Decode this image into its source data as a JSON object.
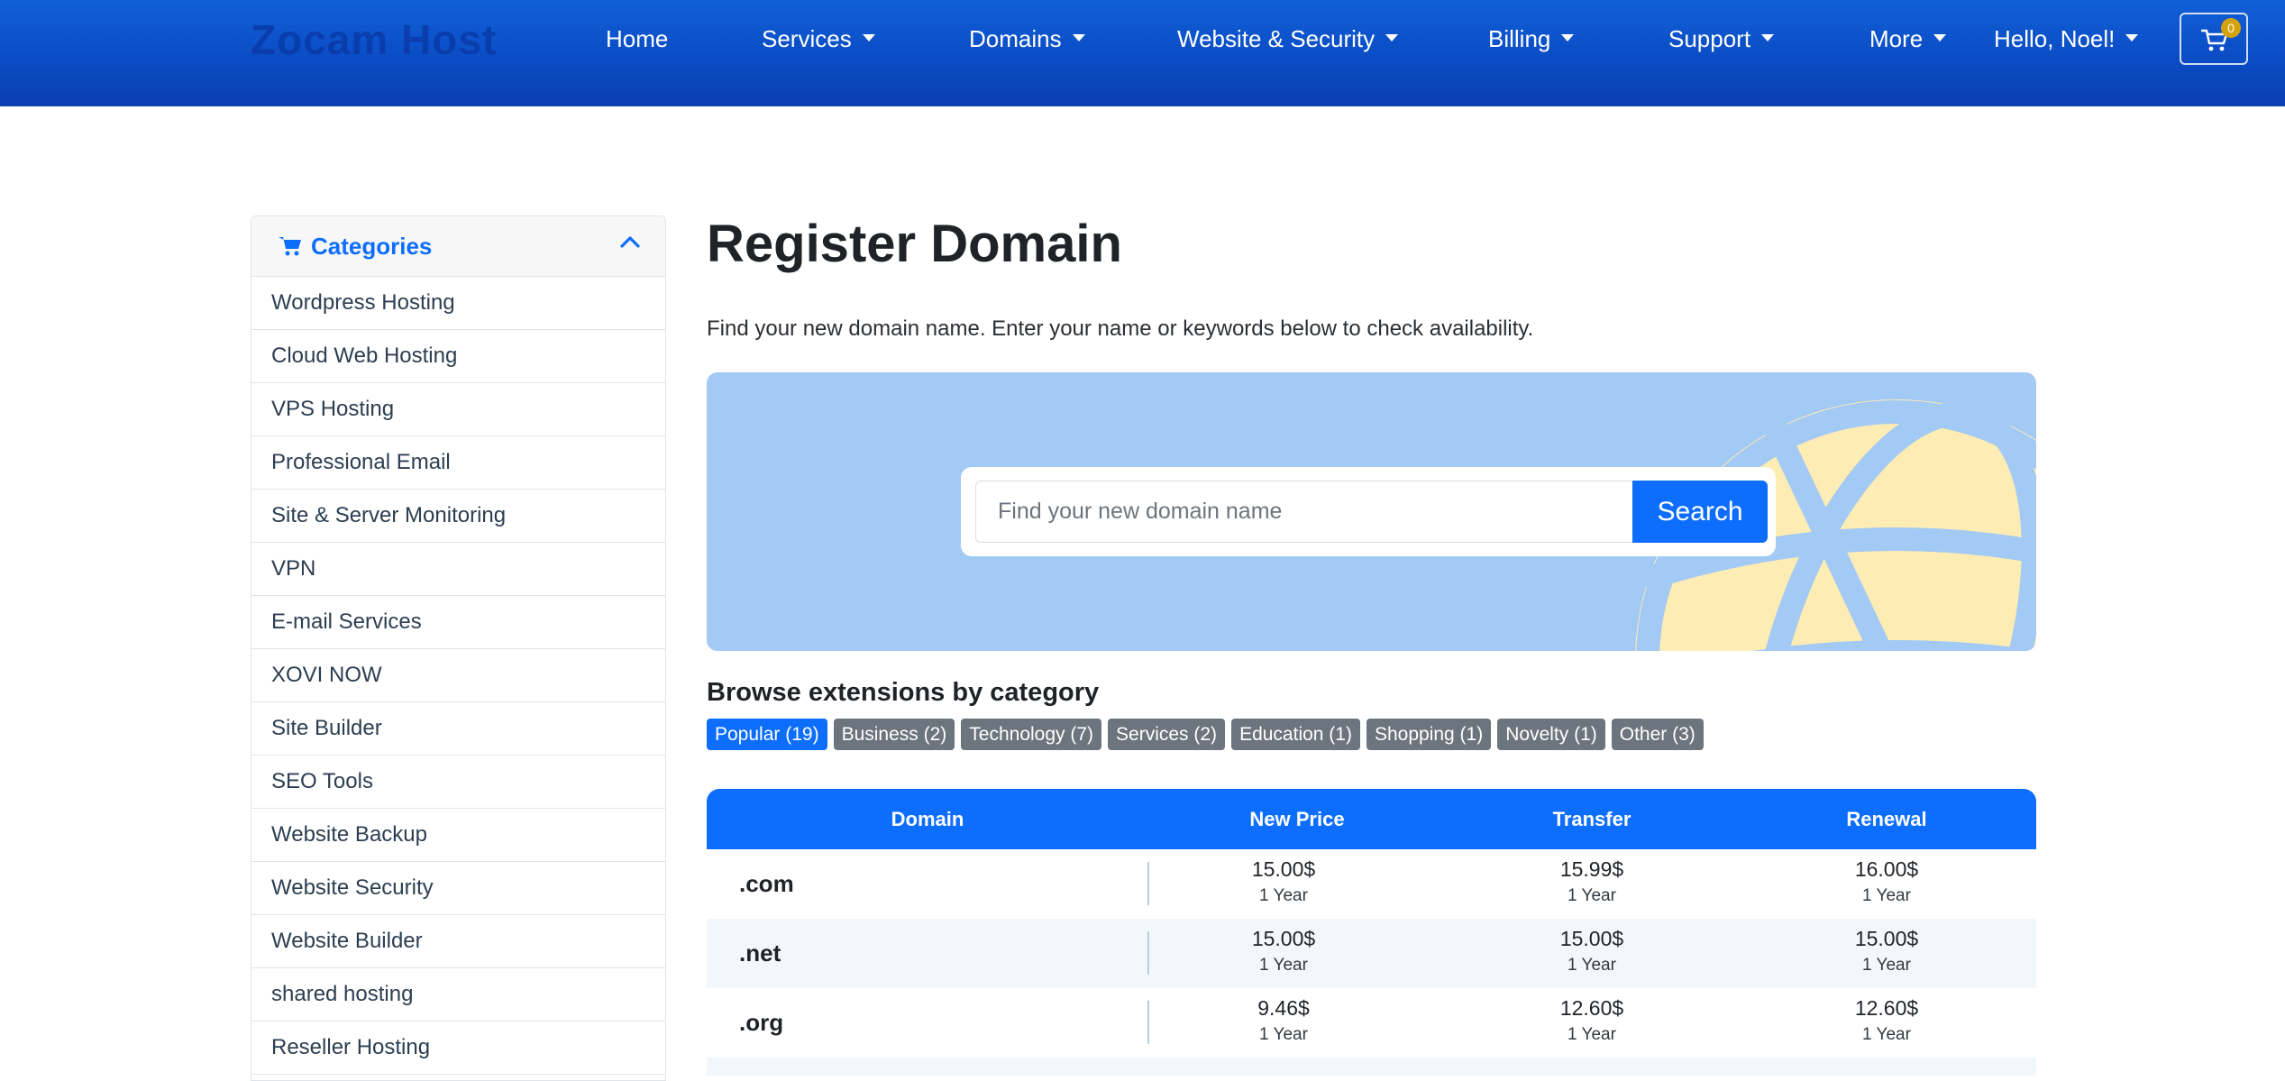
{
  "nav": {
    "logo": "Zocam Host",
    "items": [
      {
        "label": "Home",
        "dropdown": false
      },
      {
        "label": "Services",
        "dropdown": true
      },
      {
        "label": "Domains",
        "dropdown": true
      },
      {
        "label": "Website & Security",
        "dropdown": true
      },
      {
        "label": "Billing",
        "dropdown": true
      },
      {
        "label": "Support",
        "dropdown": true
      },
      {
        "label": "More",
        "dropdown": true
      },
      {
        "label": "Hello, Noel!",
        "dropdown": true
      }
    ],
    "cart_count": "0"
  },
  "sidebar": {
    "title": "Categories",
    "items": [
      "Wordpress Hosting",
      "Cloud Web Hosting",
      "VPS Hosting",
      "Professional Email",
      "Site & Server Monitoring",
      "VPN",
      "E-mail Services",
      "XOVI NOW",
      "Site Builder",
      "SEO Tools",
      "Website Backup",
      "Website Security",
      "Website Builder",
      "shared hosting",
      "Reseller Hosting"
    ]
  },
  "main": {
    "title": "Register Domain",
    "intro": "Find your new domain name. Enter your name or keywords below to check availability.",
    "search": {
      "placeholder": "Find your new domain name",
      "button": "Search"
    },
    "browse_title": "Browse extensions by category",
    "categories": [
      {
        "label": "Popular (19)",
        "active": true
      },
      {
        "label": "Business (2)",
        "active": false
      },
      {
        "label": "Technology (7)",
        "active": false
      },
      {
        "label": "Services (2)",
        "active": false
      },
      {
        "label": "Education (1)",
        "active": false
      },
      {
        "label": "Shopping (1)",
        "active": false
      },
      {
        "label": "Novelty (1)",
        "active": false
      },
      {
        "label": "Other (3)",
        "active": false
      }
    ],
    "table": {
      "headers": [
        "Domain",
        "New Price",
        "Transfer",
        "Renewal"
      ],
      "rows": [
        {
          "ext": ".com",
          "new_price": "15.00$",
          "transfer": "15.99$",
          "renewal": "16.00$",
          "period": "1 Year"
        },
        {
          "ext": ".net",
          "new_price": "15.00$",
          "transfer": "15.00$",
          "renewal": "15.00$",
          "period": "1 Year"
        },
        {
          "ext": ".org",
          "new_price": "9.46$",
          "transfer": "12.60$",
          "renewal": "12.60$",
          "period": "1 Year"
        }
      ]
    }
  },
  "colors": {
    "primary": "#0d6efd",
    "nav_gradient_top": "#1160d8",
    "nav_gradient_bottom": "#0a3fb0",
    "hero_bg": "#a3c9f5",
    "globe": "#fdecb4",
    "badge_gray": "#6c757d",
    "cart_badge": "#d4a20a"
  },
  "icons": {
    "cart": "shopping-cart-icon",
    "collapse": "chevron-up-icon",
    "dropdown": "caret-down-icon",
    "hero_art": "globe-icon"
  }
}
